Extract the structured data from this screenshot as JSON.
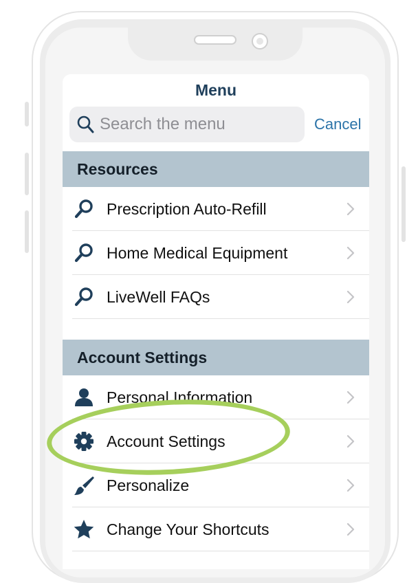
{
  "header": {
    "title": "Menu"
  },
  "search": {
    "placeholder": "Search the menu",
    "cancel_label": "Cancel"
  },
  "sections": [
    {
      "title": "Resources",
      "items": [
        {
          "label": "Prescription Auto-Refill",
          "icon": "search-icon"
        },
        {
          "label": "Home Medical Equipment",
          "icon": "search-icon"
        },
        {
          "label": "LiveWell FAQs",
          "icon": "search-icon"
        }
      ]
    },
    {
      "title": "Account Settings",
      "items": [
        {
          "label": "Personal Information",
          "icon": "person-icon"
        },
        {
          "label": "Account Settings",
          "icon": "gear-icon"
        },
        {
          "label": "Personalize",
          "icon": "paintbrush-icon"
        },
        {
          "label": "Change Your Shortcuts",
          "icon": "star-icon"
        }
      ]
    }
  ],
  "colors": {
    "title": "#1f3f5b",
    "icon": "#1f3f5b",
    "link": "#2b73a8",
    "section_header_bg": "#b3c4cf",
    "highlight_ring": "#a6cf5c"
  }
}
